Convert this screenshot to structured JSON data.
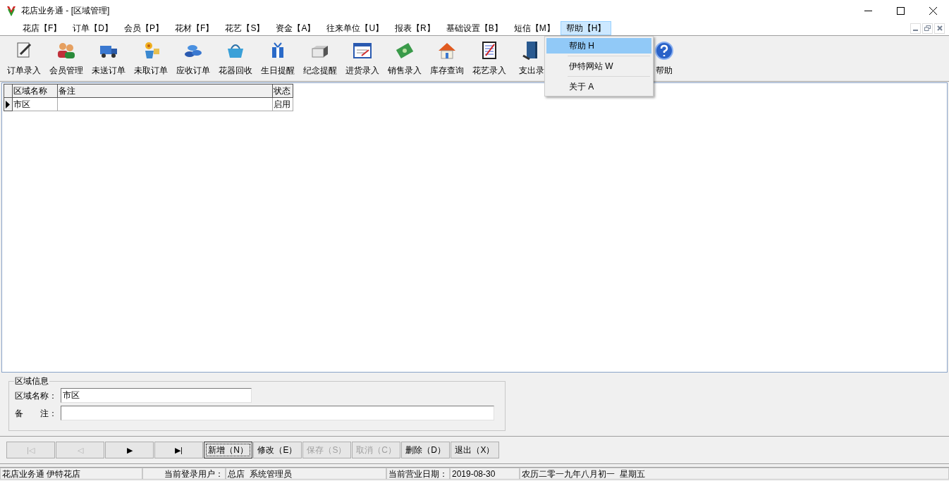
{
  "window": {
    "title": "花店业务通 - [区域管理]"
  },
  "menu": [
    {
      "label": "花店【F】",
      "selected": false
    },
    {
      "label": "订单【D】",
      "selected": false
    },
    {
      "label": "会员【P】",
      "selected": false
    },
    {
      "label": "花材【F】",
      "selected": false
    },
    {
      "label": "花艺【S】",
      "selected": false
    },
    {
      "label": "资金【A】",
      "selected": false
    },
    {
      "label": "往来单位【U】",
      "selected": false
    },
    {
      "label": "报表【R】",
      "selected": false
    },
    {
      "label": "基础设置【B】",
      "selected": false
    },
    {
      "label": "短信【M】",
      "selected": false
    },
    {
      "label": "帮助【H】",
      "selected": true
    }
  ],
  "dropdown": [
    {
      "label": "帮助 H",
      "selected": true
    },
    {
      "label": "伊特网站 W",
      "selected": false
    },
    {
      "label": "关于 A",
      "selected": false
    }
  ],
  "toolbar": [
    {
      "label": "订单录入"
    },
    {
      "label": "会员管理"
    },
    {
      "label": "未送订单"
    },
    {
      "label": "未取订单"
    },
    {
      "label": "应收订单"
    },
    {
      "label": "花器回收"
    },
    {
      "label": "生日提醒"
    },
    {
      "label": "纪念提醒"
    },
    {
      "label": "进货录入"
    },
    {
      "label": "销售录入"
    },
    {
      "label": "库存查询"
    },
    {
      "label": "花艺录入"
    },
    {
      "label": "支出录"
    },
    {
      "label": "帮助"
    }
  ],
  "table": {
    "columns": [
      "区域名称",
      "备注",
      "状态"
    ],
    "rows": [
      {
        "cells": [
          "市区",
          "",
          "启用"
        ],
        "selected": true
      }
    ]
  },
  "region_info": {
    "title": "区域信息",
    "fields": [
      {
        "label": "区域名称：",
        "value": "市区"
      },
      {
        "label": "备　　注："
      }
    ]
  },
  "nav_buttons": [
    {
      "label": "|◁",
      "disabled": true
    },
    {
      "label": "◁",
      "disabled": true
    },
    {
      "label": "▶",
      "disabled": false
    },
    {
      "label": "▶|",
      "disabled": false
    }
  ],
  "buttons": [
    {
      "label": "新增（N）",
      "disabled": false,
      "focused": true
    },
    {
      "label": "修改（E）",
      "disabled": false,
      "focused": false
    },
    {
      "label": "保存（S）",
      "disabled": true,
      "focused": false
    },
    {
      "label": "取消（C）",
      "disabled": true,
      "focused": false
    },
    {
      "label": "删除（D）",
      "disabled": false,
      "focused": false
    },
    {
      "label": "退出（X）",
      "disabled": false,
      "focused": false
    }
  ],
  "status_bar": [
    "花店业务通 伊特花店",
    "当前登录用户：",
    "总店  系统管理员",
    "当前营业日期：",
    "2019-08-30",
    "农历二零一九年八月初一  星期五"
  ]
}
